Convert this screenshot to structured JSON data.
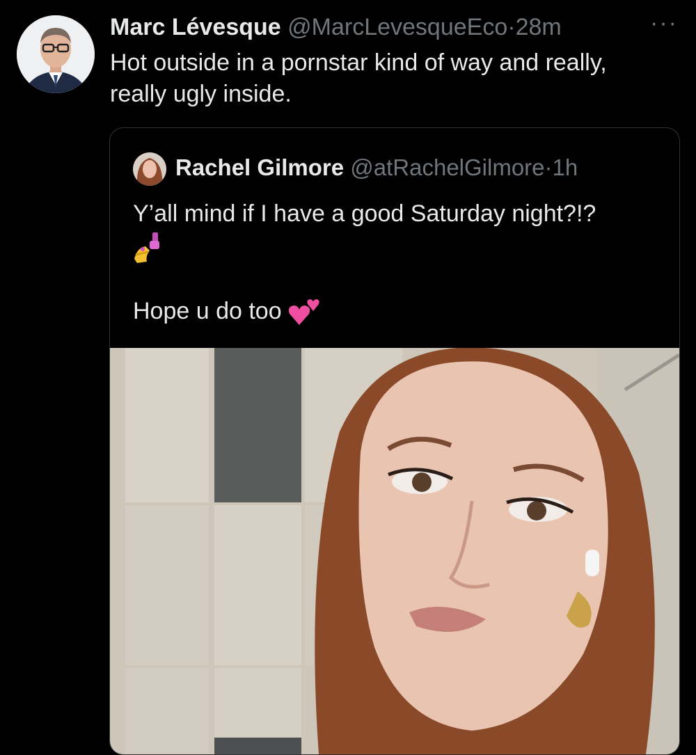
{
  "tweet": {
    "author_name": "Marc Lévesque",
    "author_handle": "@MarcLevesqueEco",
    "separator": "·",
    "time": "28m",
    "more_label": "···",
    "text_line1": "Hot outside in a pornstar kind of way and really,",
    "text_line2": "really ugly inside."
  },
  "quoted": {
    "author_name": "Rachel Gilmore",
    "author_handle": "@atRachelGilmore",
    "separator": "·",
    "time": "1h",
    "text_line1": "Y’all mind if I have a good Saturday night?!?",
    "text_line2": "Hope u do too",
    "icons": [
      "nail-polish-emoji",
      "two-hearts-emoji"
    ]
  },
  "colors": {
    "background": "#000000",
    "text": "#e7e9ea",
    "secondary": "#71767b",
    "border": "#2f3336"
  }
}
